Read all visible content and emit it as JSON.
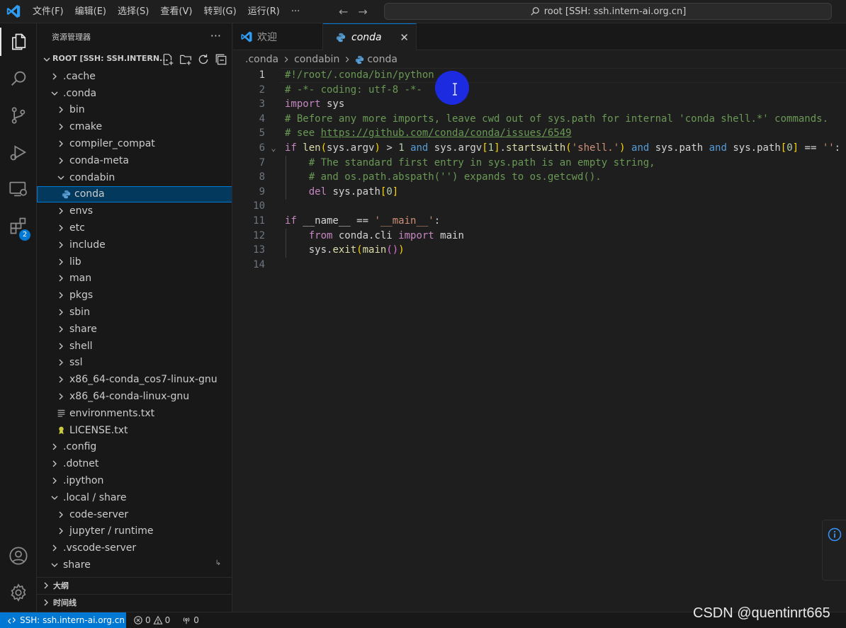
{
  "titlebar": {
    "menus": [
      "文件(F)",
      "编辑(E)",
      "选择(S)",
      "查看(V)",
      "转到(G)",
      "运行(R)",
      "···"
    ],
    "command_center": "root [SSH: ssh.intern-ai.org.cn]"
  },
  "activitybar": {
    "extensions_badge": "2"
  },
  "sidebar": {
    "title": "资源管理器",
    "root_label": "ROOT [SSH: SSH.INTERN...",
    "tree": [
      {
        "label": ".cache",
        "depth": 1,
        "chevron": "right",
        "icon": "none"
      },
      {
        "label": ".conda",
        "depth": 1,
        "chevron": "down",
        "icon": "none"
      },
      {
        "label": "bin",
        "depth": 2,
        "chevron": "right",
        "icon": "none"
      },
      {
        "label": "cmake",
        "depth": 2,
        "chevron": "right",
        "icon": "none"
      },
      {
        "label": "compiler_compat",
        "depth": 2,
        "chevron": "right",
        "icon": "none"
      },
      {
        "label": "conda-meta",
        "depth": 2,
        "chevron": "right",
        "icon": "none"
      },
      {
        "label": "condabin",
        "depth": 2,
        "chevron": "down",
        "icon": "none"
      },
      {
        "label": "conda",
        "depth": 3,
        "chevron": "none",
        "icon": "python",
        "selected": true
      },
      {
        "label": "envs",
        "depth": 2,
        "chevron": "right",
        "icon": "none"
      },
      {
        "label": "etc",
        "depth": 2,
        "chevron": "right",
        "icon": "none"
      },
      {
        "label": "include",
        "depth": 2,
        "chevron": "right",
        "icon": "none"
      },
      {
        "label": "lib",
        "depth": 2,
        "chevron": "right",
        "icon": "none"
      },
      {
        "label": "man",
        "depth": 2,
        "chevron": "right",
        "icon": "none"
      },
      {
        "label": "pkgs",
        "depth": 2,
        "chevron": "right",
        "icon": "none"
      },
      {
        "label": "sbin",
        "depth": 2,
        "chevron": "right",
        "icon": "none"
      },
      {
        "label": "share",
        "depth": 2,
        "chevron": "right",
        "icon": "none"
      },
      {
        "label": "shell",
        "depth": 2,
        "chevron": "right",
        "icon": "none"
      },
      {
        "label": "ssl",
        "depth": 2,
        "chevron": "right",
        "icon": "none"
      },
      {
        "label": "x86_64-conda_cos7-linux-gnu",
        "depth": 2,
        "chevron": "right",
        "icon": "none"
      },
      {
        "label": "x86_64-conda-linux-gnu",
        "depth": 2,
        "chevron": "right",
        "icon": "none"
      },
      {
        "label": "environments.txt",
        "depth": 2,
        "chevron": "none",
        "icon": "text"
      },
      {
        "label": "LICENSE.txt",
        "depth": 2,
        "chevron": "none",
        "icon": "license"
      },
      {
        "label": ".config",
        "depth": 1,
        "chevron": "right",
        "icon": "none"
      },
      {
        "label": ".dotnet",
        "depth": 1,
        "chevron": "right",
        "icon": "none"
      },
      {
        "label": ".ipython",
        "depth": 1,
        "chevron": "right",
        "icon": "none"
      },
      {
        "label": ".local / share",
        "depth": 1,
        "chevron": "down",
        "icon": "none"
      },
      {
        "label": "code-server",
        "depth": 2,
        "chevron": "right",
        "icon": "none"
      },
      {
        "label": "jupyter / runtime",
        "depth": 2,
        "chevron": "right",
        "icon": "none"
      },
      {
        "label": ".vscode-server",
        "depth": 1,
        "chevron": "right",
        "icon": "none"
      },
      {
        "label": "share",
        "depth": 1,
        "chevron": "down",
        "icon": "none",
        "pinned": true
      }
    ],
    "outline_label": "大纲",
    "timeline_label": "时间线"
  },
  "tabs": [
    {
      "label": "欢迎",
      "icon": "vscode-logo"
    },
    {
      "label": "conda",
      "icon": "python",
      "active": true
    }
  ],
  "breadcrumb": [
    ".conda",
    "condabin",
    "conda"
  ],
  "editor": {
    "current_line": 1,
    "line_numbers": [
      "1",
      "2",
      "3",
      "4",
      "5",
      "6",
      "7",
      "8",
      "9",
      "10",
      "11",
      "12",
      "13",
      "14"
    ],
    "folds": [
      "",
      "",
      "",
      "",
      "",
      "⌄",
      "",
      "",
      "",
      "",
      "",
      "",
      "",
      ""
    ],
    "lines": [
      [
        {
          "t": "#!/root/.conda/bin/python",
          "c": "cm"
        }
      ],
      [
        {
          "t": "# -*- coding: utf-8 -*-",
          "c": "cm"
        }
      ],
      [
        {
          "t": "import",
          "c": "kc"
        },
        {
          "t": " sys",
          "c": ""
        }
      ],
      [
        {
          "t": "# Before any more imports, leave cwd out of sys.path for internal 'conda shell.*' commands.",
          "c": "cm"
        }
      ],
      [
        {
          "t": "# see ",
          "c": "cm"
        },
        {
          "t": "https://github.com/conda/conda/issues/6549",
          "c": "url"
        }
      ],
      [
        {
          "t": "if",
          "c": "kc"
        },
        {
          "t": " ",
          "c": ""
        },
        {
          "t": "len",
          "c": "fn"
        },
        {
          "t": "(",
          "c": "br1"
        },
        {
          "t": "sys.argv",
          "c": ""
        },
        {
          "t": ")",
          "c": "br1"
        },
        {
          "t": " > ",
          "c": ""
        },
        {
          "t": "1",
          "c": "nm"
        },
        {
          "t": " ",
          "c": ""
        },
        {
          "t": "and",
          "c": "kw"
        },
        {
          "t": " sys.argv",
          "c": ""
        },
        {
          "t": "[",
          "c": "br1"
        },
        {
          "t": "1",
          "c": "nm"
        },
        {
          "t": "]",
          "c": "br1"
        },
        {
          "t": ".",
          "c": ""
        },
        {
          "t": "startswith",
          "c": "fn"
        },
        {
          "t": "(",
          "c": "br1"
        },
        {
          "t": "'shell.'",
          "c": "st"
        },
        {
          "t": ")",
          "c": "br1"
        },
        {
          "t": " ",
          "c": ""
        },
        {
          "t": "and",
          "c": "kw"
        },
        {
          "t": " sys.path ",
          "c": ""
        },
        {
          "t": "and",
          "c": "kw"
        },
        {
          "t": " sys.path",
          "c": ""
        },
        {
          "t": "[",
          "c": "br1"
        },
        {
          "t": "0",
          "c": "nm"
        },
        {
          "t": "]",
          "c": "br1"
        },
        {
          "t": " == ",
          "c": ""
        },
        {
          "t": "''",
          "c": "st"
        },
        {
          "t": ":",
          "c": ""
        }
      ],
      [
        {
          "t": "    # The standard first entry in sys.path is an empty string,",
          "c": "cm"
        }
      ],
      [
        {
          "t": "    # and os.path.abspath('') expands to os.getcwd().",
          "c": "cm"
        }
      ],
      [
        {
          "t": "    ",
          "c": ""
        },
        {
          "t": "del",
          "c": "kc"
        },
        {
          "t": " sys.path",
          "c": ""
        },
        {
          "t": "[",
          "c": "br1"
        },
        {
          "t": "0",
          "c": "nm"
        },
        {
          "t": "]",
          "c": "br1"
        }
      ],
      [
        {
          "t": "",
          "c": ""
        }
      ],
      [
        {
          "t": "if",
          "c": "kc"
        },
        {
          "t": " __name__ == ",
          "c": ""
        },
        {
          "t": "'__main__'",
          "c": "st"
        },
        {
          "t": ":",
          "c": ""
        }
      ],
      [
        {
          "t": "    ",
          "c": ""
        },
        {
          "t": "from",
          "c": "kc"
        },
        {
          "t": " conda.cli ",
          "c": ""
        },
        {
          "t": "import",
          "c": "kc"
        },
        {
          "t": " main",
          "c": ""
        }
      ],
      [
        {
          "t": "    sys.",
          "c": ""
        },
        {
          "t": "exit",
          "c": "fn"
        },
        {
          "t": "(",
          "c": "br1"
        },
        {
          "t": "main",
          "c": "fn"
        },
        {
          "t": "(",
          "c": "br2"
        },
        {
          "t": ")",
          "c": "br2"
        },
        {
          "t": ")",
          "c": "br1"
        }
      ],
      [
        {
          "t": "",
          "c": ""
        }
      ]
    ]
  },
  "statusbar": {
    "remote": "SSH: ssh.intern-ai.org.cn",
    "errors": "0",
    "warnings": "0",
    "ports": "0"
  },
  "watermark": "CSDN @quentinrt665",
  "colors": {
    "accent": "#0078d4",
    "selection": "#04395e",
    "cursor_highlight": "#1c2ae0"
  }
}
